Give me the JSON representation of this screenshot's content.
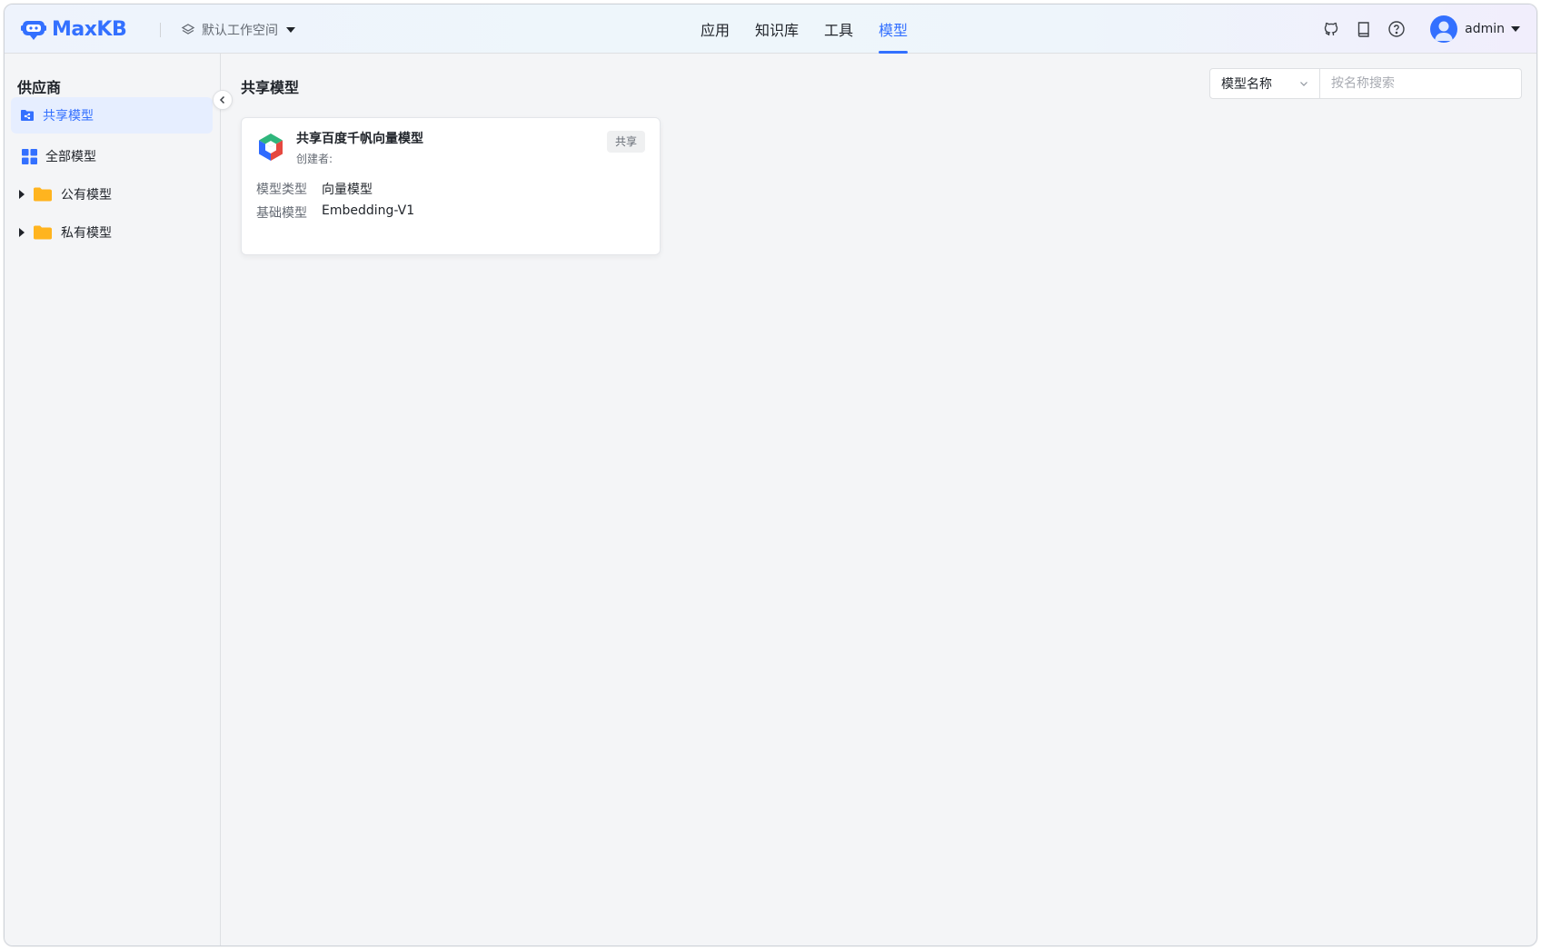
{
  "app": {
    "brand": "MaxKB",
    "accent_color": "#3370ff"
  },
  "workspace": {
    "label": "默认工作空间",
    "icon": "layers-icon"
  },
  "nav": {
    "tabs": [
      {
        "label": "应用",
        "active": false
      },
      {
        "label": "知识库",
        "active": false
      },
      {
        "label": "工具",
        "active": false
      },
      {
        "label": "模型",
        "active": true
      }
    ]
  },
  "header_icons": [
    "github-icon",
    "book-icon",
    "help-icon"
  ],
  "user": {
    "name": "admin"
  },
  "sidebar": {
    "title": "供应商",
    "items": [
      {
        "label": "共享模型",
        "icon": "shared-folder-icon",
        "active": true
      },
      {
        "label": "全部模型",
        "icon": "grid-icon",
        "active": false
      },
      {
        "label": "公有模型",
        "icon": "folder-icon",
        "expandable": true
      },
      {
        "label": "私有模型",
        "icon": "folder-icon",
        "expandable": true
      }
    ]
  },
  "main": {
    "title": "共享模型",
    "filter": {
      "select_value": "模型名称",
      "search_placeholder": "按名称搜索"
    },
    "cards": [
      {
        "name": "共享百度千帆向量模型",
        "creator_label": "创建者:",
        "badge": "共享",
        "fields": [
          {
            "key": "模型类型",
            "value": "向量模型"
          },
          {
            "key": "基础模型",
            "value": "Embedding-V1"
          }
        ]
      }
    ]
  }
}
